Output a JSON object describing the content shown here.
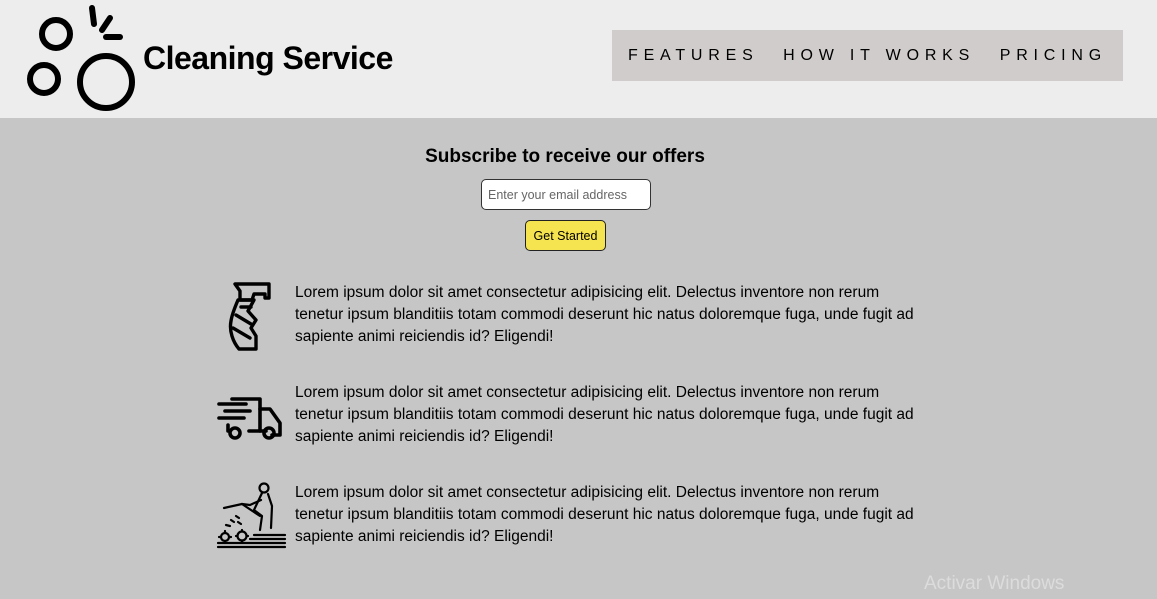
{
  "header": {
    "brand_title": "Cleaning Service",
    "logo_icon": "bubbles-icon",
    "nav": [
      {
        "label": "FEATURES"
      },
      {
        "label": "HOW IT WORKS"
      },
      {
        "label": "PRICING"
      }
    ]
  },
  "subscribe": {
    "title": "Subscribe to receive our offers",
    "email_placeholder": "Enter your email address",
    "button_label": "Get Started"
  },
  "features": [
    {
      "icon": "spray-bottle-icon",
      "text": "Lorem ipsum dolor sit amet consectetur adipisicing elit. Delectus inventore non rerum tenetur ipsum blanditiis totam commodi deserunt hic natus doloremque fuga, unde fugit ad sapiente animi reiciendis id? Eligendi!"
    },
    {
      "icon": "delivery-truck-icon",
      "text": "Lorem ipsum dolor sit amet consectetur adipisicing elit. Delectus inventore non rerum tenetur ipsum blanditiis totam commodi deserunt hic natus doloremque fuga, unde fugit ad sapiente animi reiciendis id? Eligendi!"
    },
    {
      "icon": "pressure-washer-worker-icon",
      "text": "Lorem ipsum dolor sit amet consectetur adipisicing elit. Delectus inventore non rerum tenetur ipsum blanditiis totam commodi deserunt hic natus doloremque fuga, unde fugit ad sapiente animi reiciendis id? Eligendi!"
    }
  ],
  "system": {
    "watermark": "Activar Windows"
  },
  "colors": {
    "header_bg": "#ededed",
    "page_bg": "#c6c6c6",
    "nav_bg": "#d0cccc",
    "button_bg": "#f5e44f"
  }
}
